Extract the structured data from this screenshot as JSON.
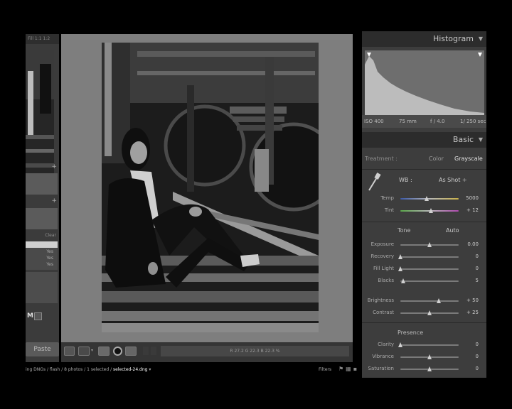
{
  "left_panel": {
    "top_bar": "Fill 1:1 1:2",
    "list_header": "Clear",
    "list_rows": [
      "",
      "Yes",
      "Yes",
      "Yes"
    ],
    "m_label": "M",
    "paste_label": "Paste"
  },
  "toolbar": {
    "zoom_readout": "R 27.2  G 22.3  B 22.3 %"
  },
  "status": {
    "path": "ing DNGs / flash / 8 photos / 1 selected / ",
    "filename": "selected-24.dng",
    "filters_label": "Filters"
  },
  "right_panel": {
    "histogram_title": "Histogram",
    "histogram_info": {
      "iso": "ISO 400",
      "focal": "75 mm",
      "aperture": "f / 4.0",
      "shutter": "1/ 250 sec"
    },
    "basic_title": "Basic",
    "treatment_label": "Treatment :",
    "treatment_color": "Color",
    "treatment_grayscale": "Grayscale",
    "wb_label": "WB :",
    "wb_value": "As Shot",
    "tone_label": "Tone",
    "auto_label": "Auto",
    "presence_label": "Presence",
    "sliders": [
      {
        "label": "Temp",
        "value": "5000",
        "pos": 0.45
      },
      {
        "label": "Tint",
        "value": "+ 12",
        "pos": 0.53
      },
      {
        "label": "Exposure",
        "value": "0.00",
        "pos": 0.5
      },
      {
        "label": "Recovery",
        "value": "0",
        "pos": 0.0
      },
      {
        "label": "Fill Light",
        "value": "0",
        "pos": 0.0
      },
      {
        "label": "Blacks",
        "value": "5",
        "pos": 0.05
      },
      {
        "label": "Brightness",
        "value": "+ 50",
        "pos": 0.66
      },
      {
        "label": "Contrast",
        "value": "+ 25",
        "pos": 0.5
      },
      {
        "label": "Clarity",
        "value": "0",
        "pos": 0.0
      },
      {
        "label": "Vibrance",
        "value": "0",
        "pos": 0.5
      },
      {
        "label": "Saturation",
        "value": "0",
        "pos": 0.5
      }
    ]
  }
}
